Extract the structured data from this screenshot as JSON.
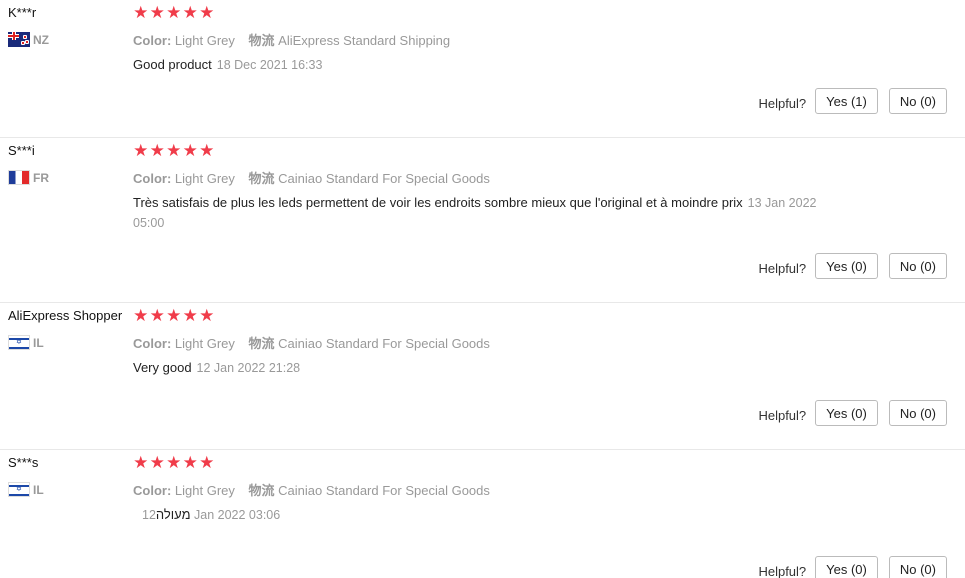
{
  "reviews": [
    {
      "user": "K***r",
      "country": "NZ",
      "rating": 5,
      "color_key": "Color:",
      "color_value": "Light Grey",
      "shipping_key": "物流",
      "shipping_value": "AliExpress Standard Shipping",
      "text": "Good product",
      "date": "18 Dec 2021 16:33",
      "helpful_label": "Helpful?",
      "yes_label": "Yes (1)",
      "no_label": "No (0)"
    },
    {
      "user": "S***i",
      "country": "FR",
      "rating": 5,
      "color_key": "Color:",
      "color_value": "Light Grey",
      "shipping_key": "物流",
      "shipping_value": "Cainiao Standard For Special Goods",
      "text": "Très satisfais de plus les leds permettent de voir les endroits sombre mieux que l'original et à moindre prix",
      "date": "13 Jan 2022 05:00",
      "helpful_label": "Helpful?",
      "yes_label": "Yes (0)",
      "no_label": "No (0)"
    },
    {
      "user": "AliExpress Shopper",
      "country": "IL",
      "rating": 5,
      "color_key": "Color:",
      "color_value": "Light Grey",
      "shipping_key": "物流",
      "shipping_value": "Cainiao Standard For Special Goods",
      "text": "Very good",
      "date": "12 Jan 2022 21:28",
      "helpful_label": "Helpful?",
      "yes_label": "Yes (0)",
      "no_label": "No (0)"
    },
    {
      "user": "S***s",
      "country": "IL",
      "rating": 5,
      "color_key": "Color:",
      "color_value": "Light Grey",
      "shipping_key": "物流",
      "shipping_value": "Cainiao Standard For Special Goods",
      "text": "מעולה",
      "date": "12 Jan 2022 03:06",
      "helpful_label": "Helpful?",
      "yes_label": "Yes (0)",
      "no_label": "No (0)"
    }
  ],
  "colors": {
    "star": "#f03c4a",
    "muted": "#999999",
    "divider": "#e8e8e8"
  },
  "icons": {
    "rating": "star-icon",
    "flag_nz": "flag-nz-icon",
    "flag_fr": "flag-fr-icon",
    "flag_il": "flag-il-icon"
  }
}
